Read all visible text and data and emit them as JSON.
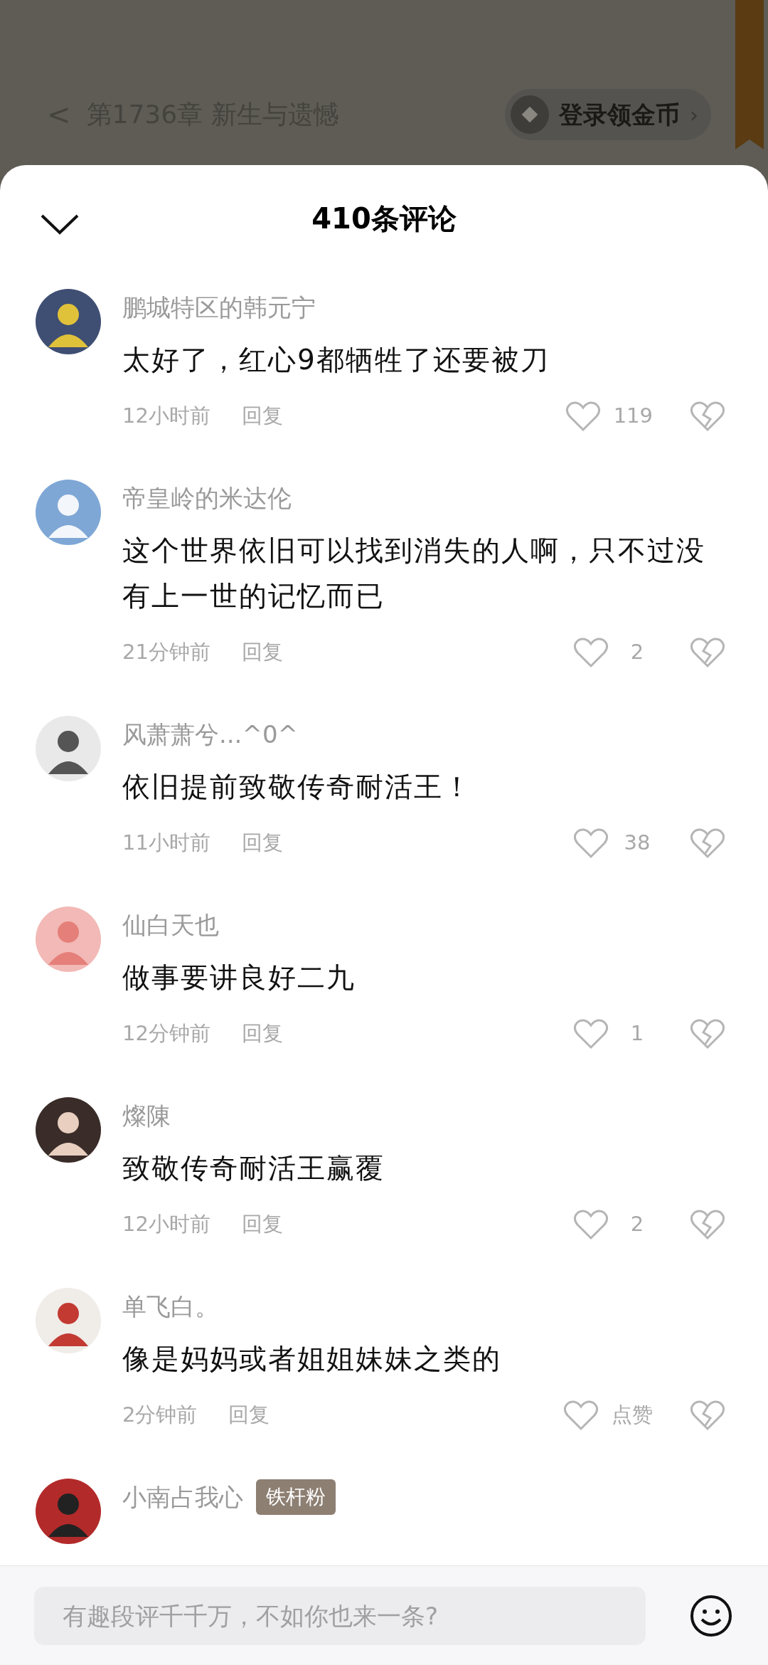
{
  "top_bar": {
    "back_icon": "<",
    "chapter_title": "第1736章 新生与遗憾",
    "coin_button": "登录领金币",
    "coin_chevron": "›"
  },
  "sheet": {
    "title": "410条评论",
    "comments": [
      {
        "name": "鹏城特区的韩元宁",
        "body": "太好了，红心9都牺牲了还要被刀",
        "time": "12小时前",
        "reply": "回复",
        "likes": "119"
      },
      {
        "name": "帝皇岭的米达伦",
        "body": "这个世界依旧可以找到消失的人啊，只不过没有上一世的记忆而已",
        "time": "21分钟前",
        "reply": "回复",
        "likes": "2"
      },
      {
        "name": "风萧萧兮...^0^",
        "body": "依旧提前致敬传奇耐活王！",
        "time": "11小时前",
        "reply": "回复",
        "likes": "38"
      },
      {
        "name": "仙白天也",
        "body": "做事要讲良好二九",
        "time": "12分钟前",
        "reply": "回复",
        "likes": "1"
      },
      {
        "name": "燦陳",
        "body": "致敬传奇耐活王赢覆",
        "time": "12小时前",
        "reply": "回复",
        "likes": "2"
      },
      {
        "name": "单飞白。",
        "body": "像是妈妈或者姐姐妹妹之类的",
        "time": "2分钟前",
        "reply": "回复",
        "likes": "点赞"
      },
      {
        "name": "小南占我心",
        "badge": "铁杆粉"
      }
    ]
  },
  "input_bar": {
    "placeholder": "有趣段评千千万，不如你也来一条?"
  }
}
